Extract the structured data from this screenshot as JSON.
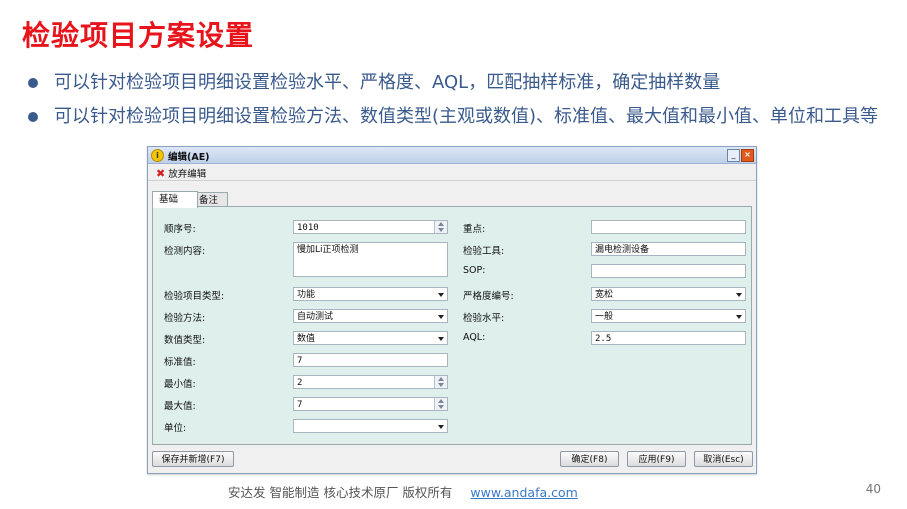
{
  "slide": {
    "title": "检验项目方案设置",
    "bullets": [
      "可以针对检验项目明细设置检验水平、严格度、AQL，匹配抽样标准，确定抽样数量",
      "可以针对检验项目明细设置检验方法、数值类型(主观或数值)、标准值、最大值和最小值、单位和工具等"
    ],
    "footer_text": "安达发   智能制造 核心技术原厂   版权所有",
    "footer_link": "www.andafa.com",
    "page_number": "40"
  },
  "dialog": {
    "title": "编辑(AE)",
    "toolbar": {
      "abandon_label": "放弃编辑"
    },
    "tabs": [
      "基础",
      "备注"
    ],
    "active_tab": "基础",
    "left": {
      "seq_label": "顺序号:",
      "seq_value": "1010",
      "content_label": "检测内容:",
      "content_value": "慢加Li正项检测",
      "item_type_label": "检验项目类型:",
      "item_type_value": "功能",
      "method_label": "检验方法:",
      "method_value": "自动测试",
      "value_type_label": "数值类型:",
      "value_type_value": "数值",
      "std_label": "标准值:",
      "std_value": "7",
      "min_label": "最小值:",
      "min_value": "2",
      "max_label": "最大值:",
      "max_value": "7",
      "unit_label": "单位:",
      "unit_value": ""
    },
    "right": {
      "key_label": "重点:",
      "key_value": "",
      "tool_label": "检验工具:",
      "tool_value": "漏电检测设备",
      "sop_label": "SOP:",
      "sop_value": "",
      "severity_label": "严格度编号:",
      "severity_value": "宽松",
      "level_label": "检验水平:",
      "level_value": "一般",
      "aql_label": "AQL:",
      "aql_value": "2.5"
    },
    "buttons": {
      "save_new": "保存并新增(F7)",
      "ok": "确定(F8)",
      "apply": "应用(F9)",
      "cancel": "取消(Esc)"
    },
    "window_buttons": {
      "minimize": "_",
      "close": "×"
    }
  }
}
